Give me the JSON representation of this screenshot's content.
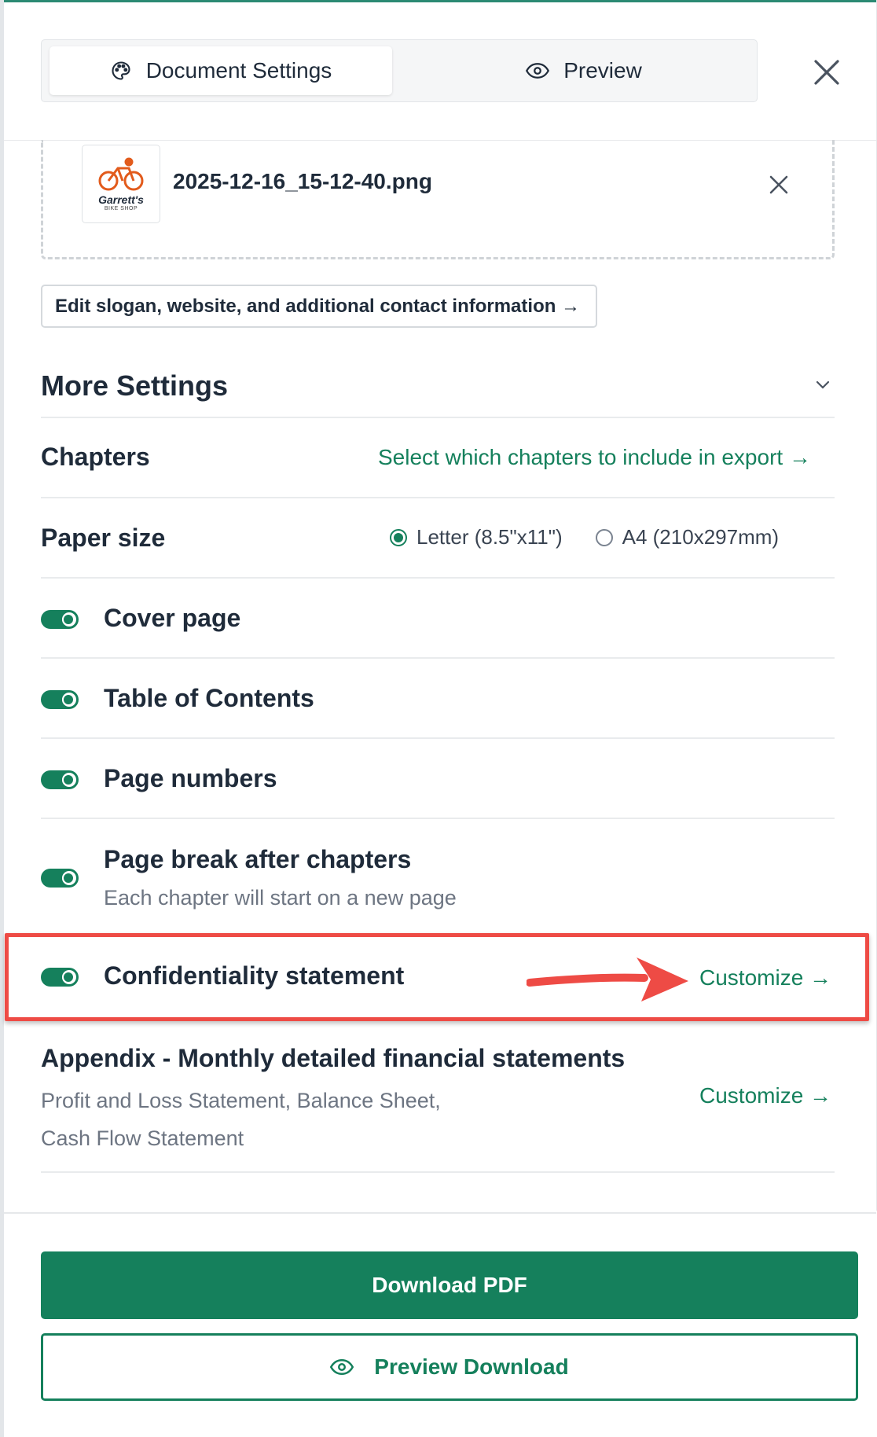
{
  "tabs": {
    "settings_label": "Document Settings",
    "preview_label": "Preview"
  },
  "upload": {
    "file_name": "2025-12-16_15-12-40.png",
    "logo_text": "Garrett's",
    "logo_subtext": "BIKE SHOP"
  },
  "edit_contact_label": "Edit slogan, website, and additional contact information →",
  "more_settings_title": "More Settings",
  "chapters": {
    "label": "Chapters",
    "link": "Select which chapters to include in export →"
  },
  "paper_size": {
    "label": "Paper size",
    "options": [
      "Letter (8.5\"x11\")",
      "A4 (210x297mm)"
    ],
    "selected": "Letter (8.5\"x11\")"
  },
  "toggles": {
    "cover_page": "Cover page",
    "toc": "Table of Contents",
    "page_numbers": "Page numbers",
    "page_break": "Page break after chapters",
    "page_break_desc": "Each chapter will start on a new page",
    "confidentiality": "Confidentiality statement",
    "confidentiality_link": "Customize →"
  },
  "appendix": {
    "title": "Appendix - Monthly detailed financial statements",
    "desc_line1": "Profit and Loss Statement, Balance Sheet,",
    "desc_line2": "Cash Flow Statement",
    "link": "Customize →"
  },
  "actions": {
    "download": "Download PDF",
    "preview": "Preview Download"
  },
  "colors": {
    "accent": "#15805c",
    "highlight": "#ee4b45"
  }
}
